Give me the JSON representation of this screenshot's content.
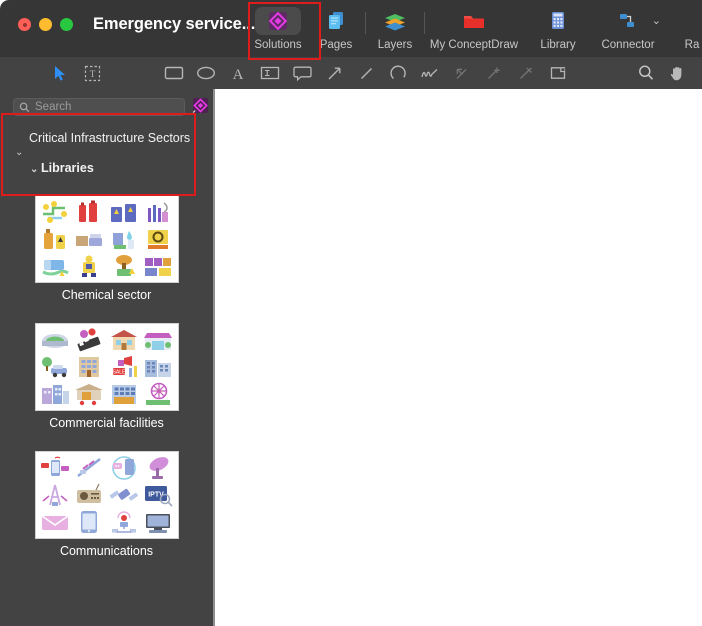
{
  "window": {
    "title": "Emergency service...",
    "traffic_lights": [
      "close",
      "minimize",
      "maximize"
    ]
  },
  "toolbar": {
    "items": [
      {
        "label": "Solutions",
        "icon": "solutions-diamond-icon",
        "selected": true
      },
      {
        "label": "Pages",
        "icon": "pages-documents-icon",
        "selected": false
      },
      {
        "label": "Layers",
        "icon": "layers-stack-icon",
        "selected": false
      },
      {
        "label": "My ConceptDraw",
        "icon": "folder-icon",
        "selected": false
      },
      {
        "label": "Library",
        "icon": "library-grid-icon",
        "selected": false
      },
      {
        "label": "Connector",
        "icon": "connector-icon",
        "selected": false
      },
      {
        "label": "Ra",
        "icon": "rapid-draw-icon",
        "selected": false
      }
    ]
  },
  "tools": {
    "items": [
      {
        "name": "pointer-tool",
        "icon": "arrow-cursor-icon",
        "state": "active"
      },
      {
        "name": "text-select-tool",
        "icon": "text-frame-icon",
        "state": "normal"
      },
      {
        "name": "rectangle-tool",
        "icon": "rectangle-icon",
        "state": "normal"
      },
      {
        "name": "ellipse-tool",
        "icon": "ellipse-icon",
        "state": "normal"
      },
      {
        "name": "text-tool",
        "icon": "letter-a-icon",
        "state": "normal"
      },
      {
        "name": "text-block-tool",
        "icon": "text-block-icon",
        "state": "normal"
      },
      {
        "name": "callout-tool",
        "icon": "speech-bubble-icon",
        "state": "normal"
      },
      {
        "name": "arrow-tool",
        "icon": "diagonal-arrow-icon",
        "state": "normal"
      },
      {
        "name": "line-tool",
        "icon": "line-icon",
        "state": "normal"
      },
      {
        "name": "arc-tool",
        "icon": "arc-icon",
        "state": "normal"
      },
      {
        "name": "freehand-tool",
        "icon": "scribble-icon",
        "state": "normal"
      },
      {
        "name": "pen-tool",
        "icon": "pen-point-icon",
        "state": "disabled"
      },
      {
        "name": "add-point-tool",
        "icon": "pen-add-point-icon",
        "state": "disabled"
      },
      {
        "name": "delete-point-tool",
        "icon": "pen-delete-point-icon",
        "state": "disabled"
      },
      {
        "name": "smart-shape-tool",
        "icon": "smart-connector-icon",
        "state": "normal"
      },
      {
        "name": "zoom-tool",
        "icon": "magnifier-icon",
        "state": "normal"
      },
      {
        "name": "pan-tool",
        "icon": "hand-icon",
        "state": "normal"
      }
    ]
  },
  "search": {
    "placeholder": "Search",
    "value": "",
    "icon": "search-icon",
    "badge_icon": "solutions-diamond-icon"
  },
  "tree": {
    "root": {
      "label": "Critical Infrastructure Sectors",
      "chevron": "chevron-down-icon",
      "expanded": true
    },
    "child": {
      "label": "Libraries",
      "chevron": "chevron-down-icon",
      "expanded": true
    }
  },
  "libraries": [
    {
      "name": "Chemical sector",
      "thumbnail": "chemical-sector-icons"
    },
    {
      "name": "Commercial facilities",
      "thumbnail": "commercial-facilities-icons"
    },
    {
      "name": "Communications",
      "thumbnail": "communications-icons"
    }
  ],
  "annotations": [
    {
      "target": "solutions-toolbar-button",
      "color": "#e01b1b"
    },
    {
      "target": "sidebar-tree",
      "color": "#e01b1b"
    }
  ],
  "colors": {
    "titlebar_bg": "#363636",
    "toolbar_bg": "#434343",
    "sidebar_bg": "#434343",
    "canvas_bg": "#ffffff",
    "annotation_red": "#e01b1b",
    "accent_magenta": "#c72ac7",
    "text_primary": "#ffffff",
    "text_secondary": "#c7c7c7"
  }
}
